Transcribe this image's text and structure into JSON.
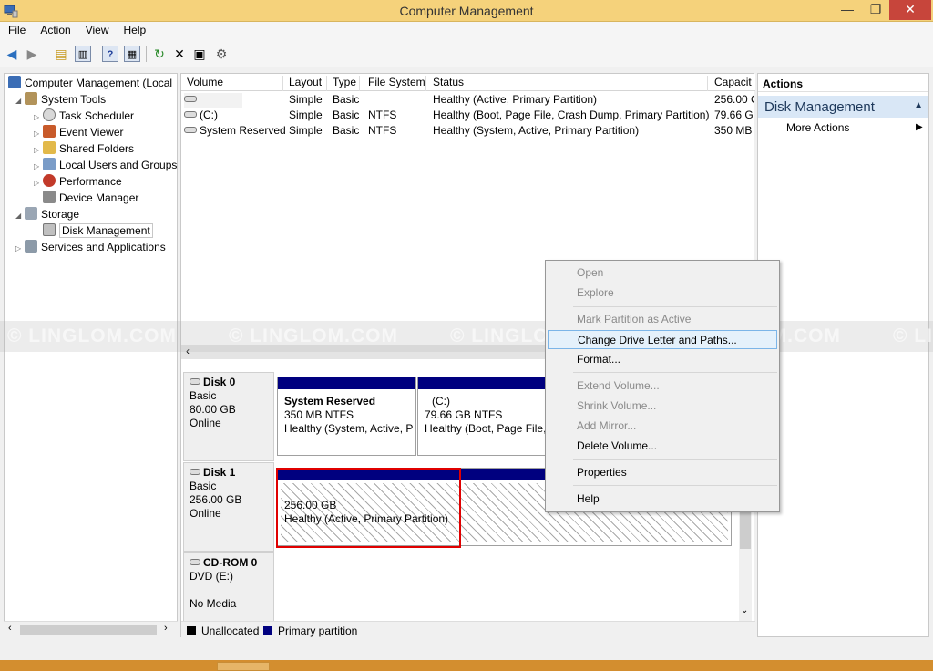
{
  "window": {
    "title": "Computer Management"
  },
  "menu": [
    "File",
    "Action",
    "View",
    "Help"
  ],
  "tree": {
    "root": "Computer Management (Local",
    "system_tools": "System Tools",
    "task_scheduler": "Task Scheduler",
    "event_viewer": "Event Viewer",
    "shared_folders": "Shared Folders",
    "local_users": "Local Users and Groups",
    "performance": "Performance",
    "device_manager": "Device Manager",
    "storage": "Storage",
    "disk_management": "Disk Management",
    "services": "Services and Applications"
  },
  "columns": [
    "Volume",
    "Layout",
    "Type",
    "File System",
    "Status",
    "Capacit"
  ],
  "volumes": [
    {
      "volume": "",
      "layout": "Simple",
      "type": "Basic",
      "fs": "",
      "status": "Healthy (Active, Primary Partition)",
      "capacity": "256.00 C"
    },
    {
      "volume": "(C:)",
      "layout": "Simple",
      "type": "Basic",
      "fs": "NTFS",
      "status": "Healthy (Boot, Page File, Crash Dump, Primary Partition)",
      "capacity": "79.66 GE"
    },
    {
      "volume": "System Reserved",
      "layout": "Simple",
      "type": "Basic",
      "fs": "NTFS",
      "status": "Healthy (System, Active, Primary Partition)",
      "capacity": "350 MB"
    }
  ],
  "disks": {
    "disk0": {
      "name": "Disk 0",
      "type": "Basic",
      "size": "80.00 GB",
      "state": "Online"
    },
    "disk1": {
      "name": "Disk 1",
      "type": "Basic",
      "size": "256.00 GB",
      "state": "Online"
    },
    "cdrom": {
      "name": "CD-ROM 0",
      "type": "DVD (E:)",
      "state": "No Media"
    }
  },
  "partitions": {
    "sysres": {
      "name": "System Reserved",
      "size": "350 MB NTFS",
      "status": "Healthy (System, Active, P"
    },
    "c": {
      "name": "(C:)",
      "size": "79.66 GB NTFS",
      "status": "Healthy (Boot, Page File,"
    },
    "new": {
      "size": "256.00 GB",
      "status": "Healthy (Active, Primary Partition)"
    }
  },
  "legend": {
    "unallocated": "Unallocated",
    "primary": "Primary partition",
    "unallocated_color": "#000000",
    "primary_color": "#00007f"
  },
  "actions": {
    "header": "Actions",
    "section": "Disk Management",
    "more": "More Actions"
  },
  "context_menu": {
    "open": "Open",
    "explore": "Explore",
    "mark_active": "Mark Partition as Active",
    "change_letter": "Change Drive Letter and Paths...",
    "format": "Format...",
    "extend": "Extend Volume...",
    "shrink": "Shrink Volume...",
    "mirror": "Add Mirror...",
    "delete": "Delete Volume...",
    "properties": "Properties",
    "help": "Help"
  },
  "watermark": "© LINGLOM.COM"
}
